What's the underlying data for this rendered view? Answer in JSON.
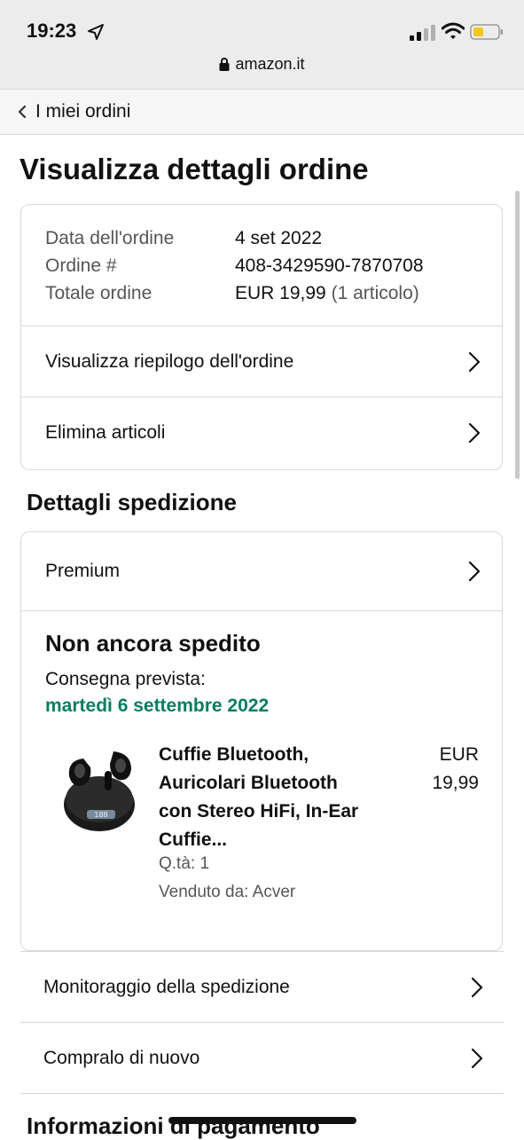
{
  "status_bar": {
    "time": "19:23"
  },
  "browser": {
    "url": "amazon.it"
  },
  "nav": {
    "back_label": "I miei ordini"
  },
  "page": {
    "title": "Visualizza dettagli ordine"
  },
  "order_summary": {
    "date_label": "Data dell'ordine",
    "date_value": "4 set 2022",
    "order_label": "Ordine #",
    "order_value": "408-3429590-7870708",
    "total_label": "Totale ordine",
    "total_value": "EUR 19,99",
    "total_items": "(1 articolo)"
  },
  "order_actions": [
    {
      "label": "Visualizza riepilogo dell'ordine"
    },
    {
      "label": "Elimina articoli"
    }
  ],
  "shipping": {
    "section_title": "Dettagli spedizione",
    "premium_label": "Premium",
    "status": "Non ancora spedito",
    "delivery_label": "Consegna prevista:",
    "delivery_date": "martedì 6 settembre 2022",
    "delivery_color": "#067d62"
  },
  "product": {
    "title": "Cuffie Bluetooth, Auricolari Bluetooth con Stereo HiFi, In-Ear Cuffie...",
    "price": "EUR 19,99",
    "quantity": "Q.tà: 1",
    "seller": "Venduto da: Acver",
    "image_icon": "earbuds-icon"
  },
  "shipment_actions": [
    {
      "label": "Monitoraggio della spedizione"
    },
    {
      "label": "Compralo di nuovo"
    }
  ],
  "payment": {
    "section_title": "Informazioni di pagamento"
  }
}
